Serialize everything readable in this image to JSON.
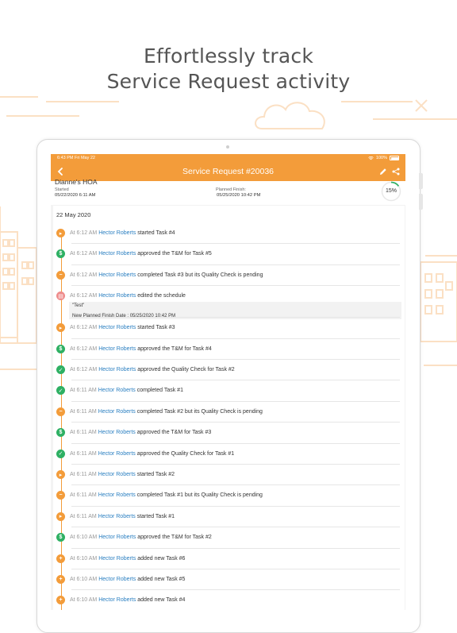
{
  "headline": {
    "line1": "Effortlessly track",
    "line2": "Service Request activity"
  },
  "status_bar": {
    "time": "6:43 PM  Fri May 22",
    "battery": "100%"
  },
  "nav": {
    "title": "Service Request #20036",
    "back_icon": "chevron-left-icon",
    "edit_icon": "pencil-icon",
    "share_icon": "share-icon"
  },
  "summary": {
    "hoa": "Dianne's HOA",
    "started_label": "Started",
    "started_value": "05/22/2020 6:11 AM",
    "planned_label": "Planned Finish:",
    "planned_value": "05/25/2020 10:42 PM",
    "progress_label": "15%",
    "progress_fraction": 0.15
  },
  "date_header": "22 May 2020",
  "colors": {
    "accent": "#f39c3a",
    "green": "#2eb063",
    "link": "#2a7fc1",
    "pink": "#ee8b8b"
  },
  "events": [
    {
      "time": "At 6:12 AM",
      "user": "Hector Roberts",
      "action": "started Task #4",
      "icon": "play-icon",
      "color": "#f39c3a"
    },
    {
      "time": "At 6:12 AM",
      "user": "Hector Roberts",
      "action": "approved the T&M for Task #5",
      "icon": "dollar-icon",
      "color": "#2eb063"
    },
    {
      "time": "At 6:12 AM",
      "user": "Hector Roberts",
      "action": "completed Task #3 but its Quality Check is pending",
      "icon": "pending-icon",
      "color": "#f39c3a"
    },
    {
      "time": "At 6:12 AM",
      "user": "Hector Roberts",
      "action": " edited the schedule",
      "icon": "calendar-icon",
      "color": "#ee8b8b",
      "note": "\"Test\"",
      "detail": "New Planned Finish Date : 05/25/2020 10:42 PM"
    },
    {
      "time": "At 6:12 AM",
      "user": "Hector Roberts",
      "action": "started Task #3",
      "icon": "play-icon",
      "color": "#f39c3a"
    },
    {
      "time": "At 6:12 AM",
      "user": "Hector Roberts",
      "action": "approved the T&M for Task #4",
      "icon": "dollar-icon",
      "color": "#2eb063"
    },
    {
      "time": "At 6:12 AM",
      "user": "Hector Roberts",
      "action": "approved the Quality Check for Task #2",
      "icon": "quality-check-icon",
      "color": "#2eb063"
    },
    {
      "time": "At 6:11 AM",
      "user": "Hector Roberts",
      "action": "completed Task #1",
      "icon": "check-icon",
      "color": "#2eb063"
    },
    {
      "time": "At 6:11 AM",
      "user": "Hector Roberts",
      "action": "completed Task #2 but its Quality Check is pending",
      "icon": "pending-icon",
      "color": "#f39c3a"
    },
    {
      "time": "At 6:11 AM",
      "user": "Hector Roberts",
      "action": "approved the T&M for Task #3",
      "icon": "dollar-icon",
      "color": "#2eb063"
    },
    {
      "time": "At 6:11 AM",
      "user": "Hector Roberts",
      "action": "approved the Quality Check for Task #1",
      "icon": "quality-check-icon",
      "color": "#2eb063"
    },
    {
      "time": "At 6:11 AM",
      "user": "Hector Roberts",
      "action": "started Task #2",
      "icon": "play-icon",
      "color": "#f39c3a"
    },
    {
      "time": "At 6:11 AM",
      "user": "Hector Roberts",
      "action": "completed Task #1 but its Quality Check is pending",
      "icon": "pending-icon",
      "color": "#f39c3a"
    },
    {
      "time": "At 6:11 AM",
      "user": "Hector Roberts",
      "action": "started Task #1",
      "icon": "play-icon",
      "color": "#f39c3a"
    },
    {
      "time": "At 6:10 AM",
      "user": "Hector Roberts",
      "action": "approved the T&M for Task #2",
      "icon": "dollar-icon",
      "color": "#2eb063"
    },
    {
      "time": "At 6:10 AM",
      "user": "Hector Roberts",
      "action": "added new Task #6",
      "icon": "add-icon",
      "color": "#f39c3a"
    },
    {
      "time": "At 6:10 AM",
      "user": "Hector Roberts",
      "action": "added new Task #5",
      "icon": "add-icon",
      "color": "#f39c3a"
    },
    {
      "time": "At 6:10 AM",
      "user": "Hector Roberts",
      "action": "added new Task #4",
      "icon": "add-icon",
      "color": "#f39c3a"
    }
  ]
}
